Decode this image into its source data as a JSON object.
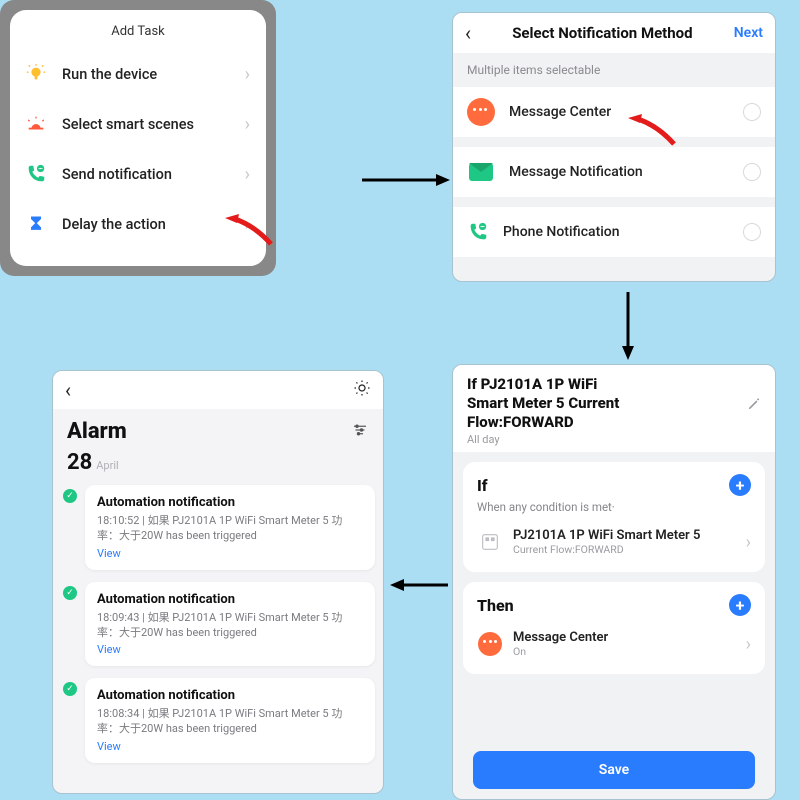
{
  "panel1": {
    "title": "Add Task",
    "items": [
      {
        "label": "Run the device",
        "icon": "bulb-icon"
      },
      {
        "label": "Select smart scenes",
        "icon": "sunrise-icon"
      },
      {
        "label": "Send notification",
        "icon": "phone-bubble-icon"
      },
      {
        "label": "Delay the action",
        "icon": "hourglass-icon"
      }
    ]
  },
  "panel2": {
    "title": "Select Notification Method",
    "next": "Next",
    "subtitle": "Multiple items selectable",
    "items": [
      {
        "label": "Message Center",
        "icon": "message-bubble-icon",
        "color": "#ff6b3d"
      },
      {
        "label": "Message Notification",
        "icon": "envelope-icon",
        "color": "#1fc785"
      },
      {
        "label": "Phone Notification",
        "icon": "phone-icon",
        "color": "#1fc785"
      }
    ]
  },
  "panel3": {
    "title_l1": "If PJ2101A 1P WiFi",
    "title_l2": "Smart Meter  5 Current",
    "title_l3": "Flow:FORWARD",
    "allday": "All day",
    "if": {
      "title": "If",
      "subtitle": "When any condition is met·",
      "item_title": "PJ2101A 1P WiFi Smart Meter 5",
      "item_sub": "Current Flow:FORWARD"
    },
    "then": {
      "title": "Then",
      "item_title": "Message Center",
      "item_sub": "On"
    },
    "save": "Save"
  },
  "panel4": {
    "title": "Alarm",
    "day": "28",
    "month": "April",
    "view": "View",
    "items": [
      {
        "title": "Automation notification",
        "body": "18:10:52 | 如果 PJ2101A 1P WiFi Smart Meter  5 功率：大于20W has been triggered"
      },
      {
        "title": "Automation notification",
        "body": "18:09:43 | 如果 PJ2101A 1P WiFi Smart Meter  5 功率：大于20W has been triggered"
      },
      {
        "title": "Automation notification",
        "body": "18:08:34 | 如果 PJ2101A 1P WiFi Smart Meter  5 功率：大于20W has been triggered"
      }
    ]
  }
}
